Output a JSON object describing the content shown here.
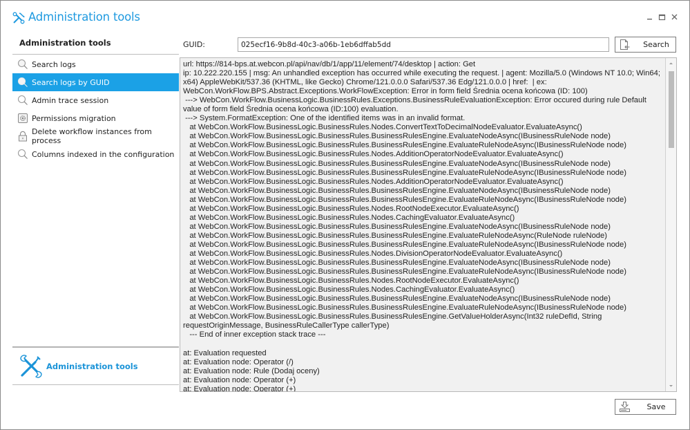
{
  "window": {
    "title": "Administration tools",
    "controls": {
      "minimize": "minimize",
      "maximize": "maximize",
      "close": "close"
    }
  },
  "sidebar": {
    "header": "Administration tools",
    "items": [
      {
        "label": "Search logs",
        "icon": "search-icon",
        "active": false
      },
      {
        "label": "Search logs by GUID",
        "icon": "search-icon",
        "active": true
      },
      {
        "label": "Admin trace session",
        "icon": "search-icon",
        "active": false
      },
      {
        "label": "Permissions migration",
        "icon": "gear-icon",
        "active": false
      },
      {
        "label": "Delete workflow instances from process",
        "icon": "lock-icon",
        "active": false
      },
      {
        "label": "Columns indexed in the configuration",
        "icon": "search-icon",
        "active": false
      }
    ],
    "brand": {
      "label": "Administration tools",
      "icon": "tools-icon"
    }
  },
  "guid": {
    "label": "GUID:",
    "value": "025ecf16-9b8d-40c3-a06b-1eb6dffab5dd"
  },
  "buttons": {
    "search": "Search",
    "save": "Save"
  },
  "colors": {
    "accent": "#1ba1e6",
    "title": "#1f9ae0",
    "log_background": "#f1f1f1"
  },
  "log": {
    "text": "url: https://814-bps.at.webcon.pl/api/nav/db/1/app/11/element/74/desktop | action: Get\nip: 10.222.220.155 | msg: An unhandled exception has occurred while executing the request. | agent: Mozilla/5.0 (Windows NT 10.0; Win64; x64) AppleWebKit/537.36 (KHTML, like Gecko) Chrome/121.0.0.0 Safari/537.36 Edg/121.0.0.0 | href:  | ex: WebCon.WorkFlow.BPS.Abstract.Exceptions.WorkFlowException: Error in form field Średnia ocena końcowa (ID: 100)\n ---> WebCon.WorkFlow.BusinessLogic.BusinessRules.Exceptions.BusinessRuleEvaluationException: Error occured during rule Default value of form field Średnia ocena końcowa (ID:100) evaluation.\n ---> System.FormatException: One of the identified items was in an invalid format.\n   at WebCon.WorkFlow.BusinessLogic.BusinessRules.Nodes.ConvertTextToDecimalNodeEvaluator.EvaluateAsync()\n   at WebCon.WorkFlow.BusinessLogic.BusinessRules.BusinessRulesEngine.EvaluateNodeAsync(IBusinessRuleNode node)\n   at WebCon.WorkFlow.BusinessLogic.BusinessRules.BusinessRulesEngine.EvaluateRuleNodeAsync(IBusinessRuleNode node)\n   at WebCon.WorkFlow.BusinessLogic.BusinessRules.Nodes.AdditionOperatorNodeEvaluator.EvaluateAsync()\n   at WebCon.WorkFlow.BusinessLogic.BusinessRules.BusinessRulesEngine.EvaluateNodeAsync(IBusinessRuleNode node)\n   at WebCon.WorkFlow.BusinessLogic.BusinessRules.BusinessRulesEngine.EvaluateRuleNodeAsync(IBusinessRuleNode node)\n   at WebCon.WorkFlow.BusinessLogic.BusinessRules.Nodes.AdditionOperatorNodeEvaluator.EvaluateAsync()\n   at WebCon.WorkFlow.BusinessLogic.BusinessRules.BusinessRulesEngine.EvaluateNodeAsync(IBusinessRuleNode node)\n   at WebCon.WorkFlow.BusinessLogic.BusinessRules.BusinessRulesEngine.EvaluateRuleNodeAsync(IBusinessRuleNode node)\n   at WebCon.WorkFlow.BusinessLogic.BusinessRules.Nodes.RootNodeExecutor.EvaluateAsync()\n   at WebCon.WorkFlow.BusinessLogic.BusinessRules.Nodes.CachingEvaluator.EvaluateAsync()\n   at WebCon.WorkFlow.BusinessLogic.BusinessRules.BusinessRulesEngine.EvaluateNodeAsync(IBusinessRuleNode node)\n   at WebCon.WorkFlow.BusinessLogic.BusinessRules.BusinessRulesEngine.EvaluateRuleNodeAsync(RuleNode ruleNode)\n   at WebCon.WorkFlow.BusinessLogic.BusinessRules.BusinessRulesEngine.EvaluateRuleNodeAsync(IBusinessRuleNode node)\n   at WebCon.WorkFlow.BusinessLogic.BusinessRules.Nodes.DivisionOperatorNodeEvaluator.EvaluateAsync()\n   at WebCon.WorkFlow.BusinessLogic.BusinessRules.BusinessRulesEngine.EvaluateNodeAsync(IBusinessRuleNode node)\n   at WebCon.WorkFlow.BusinessLogic.BusinessRules.BusinessRulesEngine.EvaluateRuleNodeAsync(IBusinessRuleNode node)\n   at WebCon.WorkFlow.BusinessLogic.BusinessRules.Nodes.RootNodeExecutor.EvaluateAsync()\n   at WebCon.WorkFlow.BusinessLogic.BusinessRules.Nodes.CachingEvaluator.EvaluateAsync()\n   at WebCon.WorkFlow.BusinessLogic.BusinessRules.BusinessRulesEngine.EvaluateNodeAsync(IBusinessRuleNode node)\n   at WebCon.WorkFlow.BusinessLogic.BusinessRules.BusinessRulesEngine.EvaluateRuleNodeAsync(IBusinessRuleNode node)\n   at WebCon.WorkFlow.BusinessLogic.BusinessRules.BusinessRulesEngine.GetValueHolderAsync(Int32 ruleDefId, String requestOriginMessage, BusinessRuleCallerType callerType)\n   --- End of inner exception stack trace ---\n\nat: Evaluation requested\nat: Evaluation node: Operator (/)\nat: Evaluation node: Rule (Dodaj oceny)\nat: Evaluation node: Operator (+)\nat: Evaluation node: Operator (+)",
    "scroll_position_fraction": 0.0,
    "scroll_visible_fraction": 0.25
  }
}
